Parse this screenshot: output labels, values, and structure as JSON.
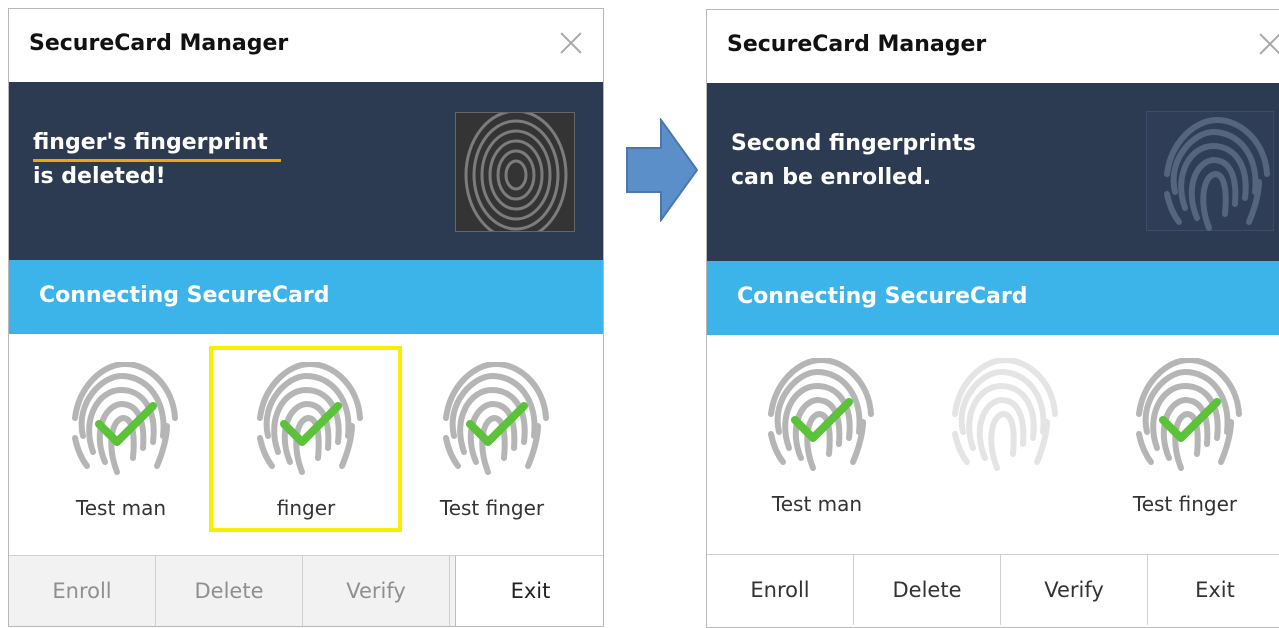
{
  "before": {
    "title": "SecureCard Manager",
    "message_line1": "finger's fingerprint",
    "message_line2": "is deleted!",
    "status": "Connecting SecureCard",
    "users": [
      {
        "label": "Test man",
        "enrolled": true
      },
      {
        "label": "finger",
        "enrolled": true,
        "highlighted": true
      },
      {
        "label": "Test finger",
        "enrolled": true
      }
    ],
    "buttons": {
      "enroll": "Enroll",
      "delete": "Delete",
      "verify": "Verify",
      "exit": "Exit"
    }
  },
  "after": {
    "title": "SecureCard Manager",
    "message_line1": "Second fingerprints",
    "message_line2": "can be enrolled.",
    "status": "Connecting SecureCard",
    "users": [
      {
        "label": "Test man",
        "enrolled": true
      },
      {
        "label": "",
        "enrolled": false
      },
      {
        "label": "Test finger",
        "enrolled": true
      }
    ],
    "buttons": {
      "enroll": "Enroll",
      "delete": "Delete",
      "verify": "Verify",
      "exit": "Exit"
    }
  },
  "colors": {
    "banner": "#2c3a52",
    "status_bar": "#3cb4ea",
    "check": "#5cc23a",
    "highlight": "#f5f000",
    "underline": "#f0a800",
    "arrow": "#5b8fc9"
  },
  "icons": {
    "slot_enrolled": "fingerprint-check-icon",
    "slot_empty": "fingerprint-empty-icon",
    "transition": "right-arrow-icon"
  }
}
